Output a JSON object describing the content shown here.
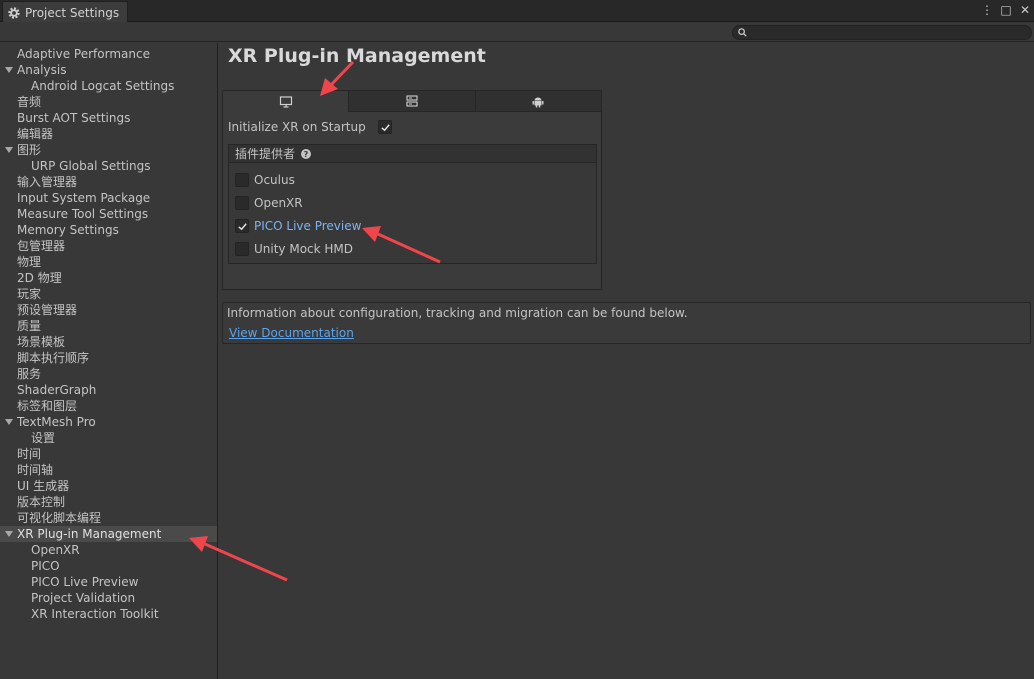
{
  "window": {
    "tab_title": "Project Settings",
    "controls": [
      "⋮",
      "□",
      "✕"
    ]
  },
  "search": {
    "placeholder": ""
  },
  "sidebar": {
    "items": [
      {
        "label": "Adaptive Performance",
        "level": 0
      },
      {
        "label": "Analysis",
        "level": 0,
        "expandable": true
      },
      {
        "label": "Android Logcat Settings",
        "level": 1
      },
      {
        "label": "音频",
        "level": 0
      },
      {
        "label": "Burst AOT Settings",
        "level": 0
      },
      {
        "label": "编辑器",
        "level": 0
      },
      {
        "label": "图形",
        "level": 0,
        "expandable": true
      },
      {
        "label": "URP Global Settings",
        "level": 1
      },
      {
        "label": "输入管理器",
        "level": 0
      },
      {
        "label": "Input System Package",
        "level": 0
      },
      {
        "label": "Measure Tool Settings",
        "level": 0
      },
      {
        "label": "Memory Settings",
        "level": 0
      },
      {
        "label": "包管理器",
        "level": 0
      },
      {
        "label": "物理",
        "level": 0
      },
      {
        "label": "2D 物理",
        "level": 0
      },
      {
        "label": "玩家",
        "level": 0
      },
      {
        "label": "预设管理器",
        "level": 0
      },
      {
        "label": "质量",
        "level": 0
      },
      {
        "label": "场景模板",
        "level": 0
      },
      {
        "label": "脚本执行顺序",
        "level": 0
      },
      {
        "label": "服务",
        "level": 0
      },
      {
        "label": "ShaderGraph",
        "level": 0
      },
      {
        "label": "标签和图层",
        "level": 0
      },
      {
        "label": "TextMesh Pro",
        "level": 0,
        "expandable": true
      },
      {
        "label": "设置",
        "level": 1
      },
      {
        "label": "时间",
        "level": 0
      },
      {
        "label": "时间轴",
        "level": 0
      },
      {
        "label": "UI 生成器",
        "level": 0
      },
      {
        "label": "版本控制",
        "level": 0
      },
      {
        "label": "可视化脚本编程",
        "level": 0
      },
      {
        "label": "XR Plug-in Management",
        "level": 0,
        "expandable": true,
        "selected": true
      },
      {
        "label": "OpenXR",
        "level": 1
      },
      {
        "label": "PICO",
        "level": 1
      },
      {
        "label": "PICO Live Preview",
        "level": 1
      },
      {
        "label": "Project Validation",
        "level": 1
      },
      {
        "label": "XR Interaction Toolkit",
        "level": 1
      }
    ]
  },
  "main": {
    "title": "XR Plug-in Management",
    "platform_tabs": [
      {
        "icon": "monitor-icon",
        "active": true
      },
      {
        "icon": "server-icon",
        "active": false
      },
      {
        "icon": "android-icon",
        "active": false
      }
    ],
    "init_on_startup": {
      "label": "Initialize XR on Startup",
      "checked": true
    },
    "providers": {
      "header": "插件提供者",
      "items": [
        {
          "label": "Oculus",
          "checked": false
        },
        {
          "label": "OpenXR",
          "checked": false
        },
        {
          "label": "PICO Live Preview",
          "checked": true
        },
        {
          "label": "Unity Mock HMD",
          "checked": false
        }
      ]
    },
    "info": {
      "text": "Information about configuration, tracking and migration can be found below.",
      "link": "View Documentation"
    }
  },
  "colors": {
    "background": "#383838",
    "accent_link": "#5aa5ee",
    "checked_label": "#7fb3f0",
    "annotation": "#f0464b"
  }
}
